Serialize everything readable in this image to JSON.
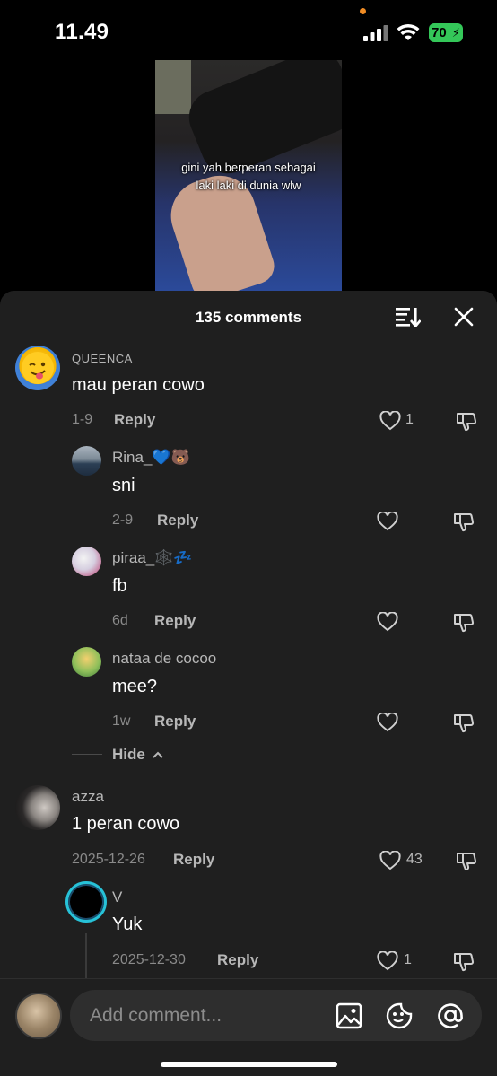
{
  "status": {
    "time": "11.49",
    "battery": "70"
  },
  "video": {
    "caption_line1": "gini yah berperan sebagai",
    "caption_line2": "laki laki di dunia wlw"
  },
  "header": {
    "count": "135 comments"
  },
  "comments": [
    {
      "username": "QUEENCA",
      "text": "mau peran cowo",
      "date": "1-9",
      "reply": "Reply",
      "likes": "1"
    },
    {
      "username": "Rina_💙🐻",
      "text": "sni",
      "date": "2-9",
      "reply": "Reply",
      "likes": ""
    },
    {
      "username": "piraa_🕸️💤",
      "text": "fb",
      "date": "6d",
      "reply": "Reply",
      "likes": ""
    },
    {
      "username": "nataa de cocoo",
      "text": "mee?",
      "date": "1w",
      "reply": "Reply",
      "likes": ""
    },
    {
      "username": "azza",
      "text": "1 peran cowo",
      "date": "2025-12-26",
      "reply": "Reply",
      "likes": "43"
    },
    {
      "username": "V",
      "text": "Yuk",
      "date": "2025-12-30",
      "reply": "Reply",
      "likes": "1"
    }
  ],
  "hide": {
    "label": "Hide"
  },
  "input": {
    "placeholder": "Add comment..."
  },
  "icons": [
    "signal-icon",
    "wifi-icon",
    "sort-icon",
    "close-icon",
    "heart-icon",
    "dislike-icon",
    "chevron-up-icon",
    "image-icon",
    "sticker-icon",
    "at-icon"
  ],
  "colors": {
    "background": "#1f1f1f",
    "battery": "#34c759",
    "dot": "#f08c24"
  }
}
